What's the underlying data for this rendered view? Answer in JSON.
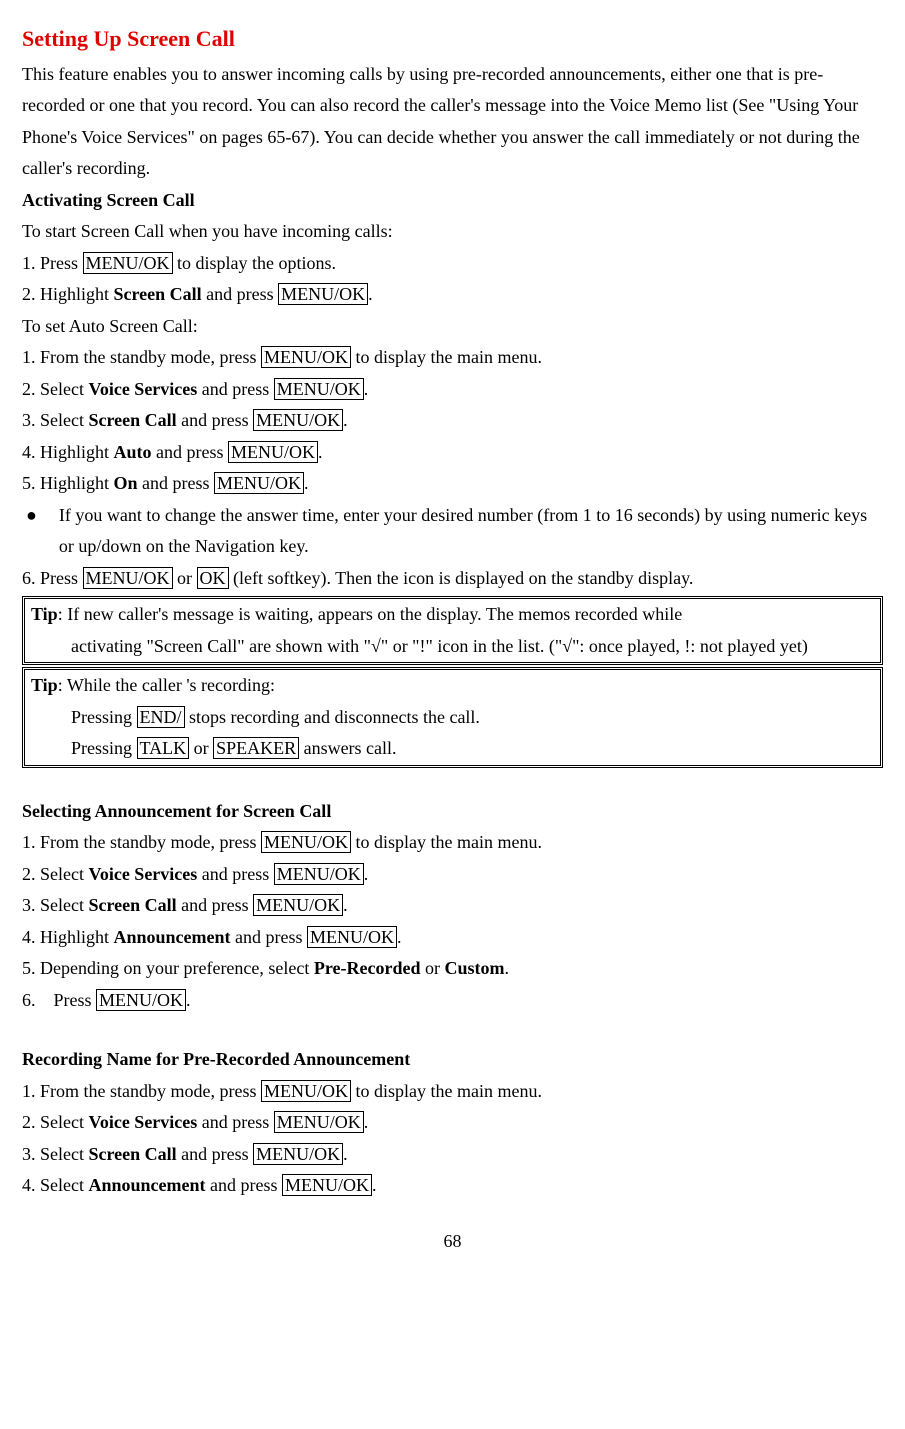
{
  "title": "Setting Up Screen Call",
  "intro": "This feature enables you to answer incoming calls by using pre-recorded announcements, either one that is pre-recorded or one that you record. You can also record the caller's message into the Voice Memo list (See \"Using Your Phone's Voice Services\" on pages 65-67). You can decide whether you answer the call immediately or not during the caller's recording.",
  "sec1": {
    "heading": "Activating Screen Call",
    "l1": "To start Screen Call when you have incoming calls:",
    "s1a": "1. Press ",
    "s1b": " to display the options.",
    "s2a": "2. Highlight ",
    "s2b": "Screen Call",
    "s2c": " and press ",
    "l2": "To set Auto Screen Call:",
    "s3a": "1. From the standby mode, press ",
    "s3b": " to display the main menu.",
    "s4a": "2. Select ",
    "s4b": "Voice Services",
    "s4c": " and press ",
    "s5a": "3. Select ",
    "s5b": "Screen Call",
    "s5c": " and press ",
    "s6a": "4. Highlight ",
    "s6b": "Auto",
    "s6c": " and press ",
    "s7a": "5. Highlight ",
    "s7b": "On",
    "s7c": " and press ",
    "bullet": "If you want to change the answer time, enter your desired number (from 1 to 16 seconds) by using numeric keys or up/down on the Navigation key.",
    "s8a": "6. Press ",
    "s8b": " or ",
    "s8c": " (left softkey). Then the icon is displayed on the standby display."
  },
  "keys": {
    "menuok": "MENU/OK",
    "ok": "OK",
    "end": "END/",
    "talk": "TALK",
    "speaker": "SPEAKER"
  },
  "tip1": {
    "label": "Tip",
    "line1": ": If new caller's message is waiting, appears on the display. The memos recorded while",
    "line2": "activating \"Screen Call\" are shown with \"√\" or \"!\" icon in the list. (\"√\": once played, !: not played yet)"
  },
  "tip2": {
    "label": "Tip",
    "line1": ": While the caller 's recording:",
    "l2a": "Pressing ",
    "l2b": " stops recording and disconnects the call.",
    "l3a": "Pressing ",
    "l3b": " or ",
    "l3c": " answers call."
  },
  "sec2": {
    "heading": "Selecting Announcement for Screen Call",
    "s1a": "1. From the standby mode, press ",
    "s1b": " to display the main menu.",
    "s2a": "2. Select ",
    "s2b": "Voice Services",
    "s2c": " and press ",
    "s3a": "3. Select ",
    "s3b": "Screen Call",
    "s3c": " and press ",
    "s4a": "4. Highlight ",
    "s4b": "Announcement",
    "s4c": " and press ",
    "s5a": "5. Depending on your preference, select ",
    "s5b": "Pre-Recorded",
    "s5c": " or ",
    "s5d": "Custom",
    "s6a": "6. Press "
  },
  "sec3": {
    "heading": "Recording Name for Pre-Recorded Announcement",
    "s1a": "1. From the standby mode, press ",
    "s1b": " to display the main menu.",
    "s2a": "2. Select ",
    "s2b": "Voice Services",
    "s2c": " and press ",
    "s3a": "3. Select ",
    "s3b": "Screen Call",
    "s3c": " and press ",
    "s4a": "4. Select ",
    "s4b": "Announcement",
    "s4c": " and press "
  },
  "dot": ".",
  "pagenum": "68"
}
